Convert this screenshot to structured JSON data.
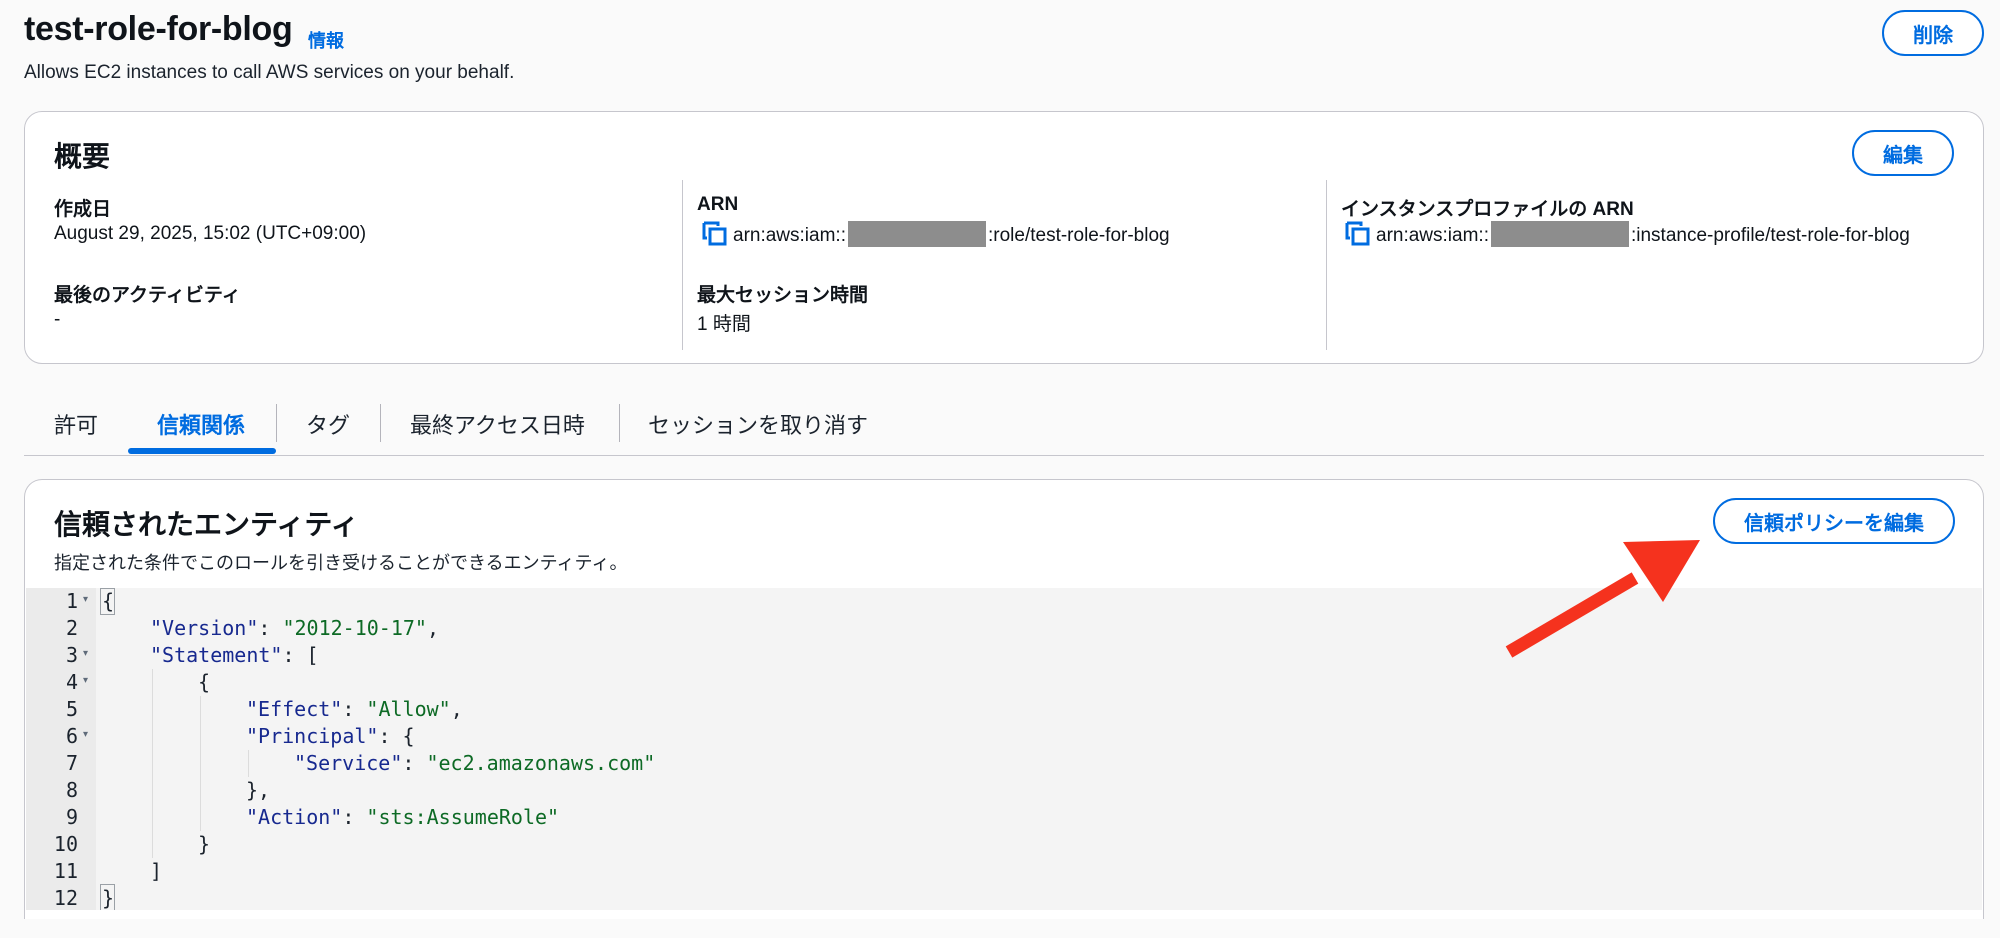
{
  "header": {
    "title": "test-role-for-blog",
    "info_link": "情報",
    "description": "Allows EC2 instances to call AWS services on your behalf.",
    "delete_button": "削除"
  },
  "summary": {
    "title": "概要",
    "edit_button": "編集",
    "created_label": "作成日",
    "created_value": "August 29, 2025, 15:02 (UTC+09:00)",
    "last_activity_label": "最後のアクティビティ",
    "last_activity_value": "-",
    "arn_label": "ARN",
    "arn_prefix": "arn:aws:iam::",
    "arn_suffix": ":role/test-role-for-blog",
    "max_session_label": "最大セッション時間",
    "max_session_value": "1 時間",
    "instance_profile_label": "インスタンスプロファイルの ARN",
    "instance_profile_prefix": "arn:aws:iam::",
    "instance_profile_suffix": ":instance-profile/test-role-for-blog"
  },
  "tabs": [
    {
      "label": "許可",
      "active": false
    },
    {
      "label": "信頼関係",
      "active": true
    },
    {
      "label": "タグ",
      "active": false
    },
    {
      "label": "最終アクセス日時",
      "active": false
    },
    {
      "label": "セッションを取り消す",
      "active": false
    }
  ],
  "trusted": {
    "title": "信頼されたエンティティ",
    "description": "指定された条件でこのロールを引き受けることができるエンティティ。",
    "edit_button": "信頼ポリシーを編集"
  },
  "code": {
    "line_numbers": [
      "1",
      "2",
      "3",
      "4",
      "5",
      "6",
      "7",
      "8",
      "9",
      "10",
      "11",
      "12"
    ],
    "lines": [
      {
        "indent": 0,
        "key": "",
        "value": "",
        "text": "{"
      },
      {
        "indent": 1,
        "key": "\"Version\"",
        "value": "\"2012-10-17\"",
        "text": ","
      },
      {
        "indent": 1,
        "key": "\"Statement\"",
        "value": "",
        "text": ": ["
      },
      {
        "indent": 2,
        "key": "",
        "value": "",
        "text": "{"
      },
      {
        "indent": 3,
        "key": "\"Effect\"",
        "value": "\"Allow\"",
        "text": ","
      },
      {
        "indent": 3,
        "key": "\"Principal\"",
        "value": "",
        "text": ": {"
      },
      {
        "indent": 4,
        "key": "\"Service\"",
        "value": "\"ec2.amazonaws.com\"",
        "text": ""
      },
      {
        "indent": 3,
        "key": "",
        "value": "",
        "text": "},"
      },
      {
        "indent": 3,
        "key": "\"Action\"",
        "value": "\"sts:AssumeRole\"",
        "text": ""
      },
      {
        "indent": 2,
        "key": "",
        "value": "",
        "text": "}"
      },
      {
        "indent": 1,
        "key": "",
        "value": "",
        "text": "]"
      },
      {
        "indent": 0,
        "key": "",
        "value": "",
        "text": "}"
      }
    ]
  },
  "colors": {
    "accent": "#006ce0",
    "annotation_arrow": "#f5321e"
  }
}
